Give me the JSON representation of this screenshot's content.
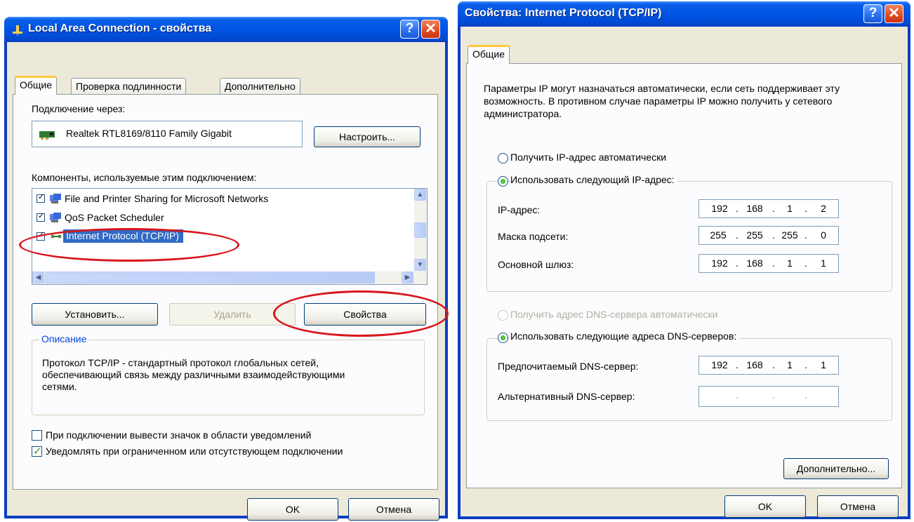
{
  "left_window": {
    "title": "Local Area Connection - свойства",
    "tabs": [
      "Общие",
      "Проверка подлинности",
      "Дополнительно"
    ],
    "connect_via_label": "Подключение через:",
    "adapter_name": "Realtek RTL8169/8110 Family Gigabit",
    "configure_button": "Настроить...",
    "components_label": "Компоненты, используемые этим подключением:",
    "components": [
      {
        "name": "File and Printer Sharing for Microsoft Networks",
        "checked": true
      },
      {
        "name": "QoS Packet Scheduler",
        "checked": true
      },
      {
        "name": "Internet Protocol (TCP/IP)",
        "checked": true,
        "selected": true
      }
    ],
    "install_button": "Установить...",
    "remove_button": "Удалить",
    "properties_button": "Свойства",
    "description_group": "Описание",
    "description_text": "Протокол TCP/IP - стандартный протокол глобальных сетей, обеспечивающий связь между различными взаимодействующими сетями.",
    "show_icon_checkbox": "При подключении вывести значок в области уведомлений",
    "show_icon_checked": false,
    "notify_checkbox": "Уведомлять при ограниченном или отсутствующем подключении",
    "notify_checked": true,
    "ok_button": "OK",
    "cancel_button": "Отмена"
  },
  "right_window": {
    "title": "Свойства: Internet Protocol (TCP/IP)",
    "tab": "Общие",
    "intro_text": "Параметры IP могут назначаться автоматически, если сеть поддерживает эту возможность. В противном случае параметры IP можно получить у сетевого администратора.",
    "auto_ip_radio": "Получить IP-адрес автоматически",
    "manual_ip_radio": "Использовать следующий IP-адрес:",
    "ip_label": "IP-адрес:",
    "ip_value": [
      "192",
      "168",
      "1",
      "2"
    ],
    "mask_label": "Маска подсети:",
    "mask_value": [
      "255",
      "255",
      "255",
      "0"
    ],
    "gateway_label": "Основной шлюз:",
    "gateway_value": [
      "192",
      "168",
      "1",
      "1"
    ],
    "auto_dns_radio": "Получить адрес DNS-сервера автоматически",
    "manual_dns_radio": "Использовать следующие адреса DNS-серверов:",
    "preferred_dns_label": "Предпочитаемый DNS-сервер:",
    "preferred_dns_value": [
      "192",
      "168",
      "1",
      "1"
    ],
    "alternate_dns_label": "Альтернативный DNS-сервер:",
    "alternate_dns_value": [
      "",
      "",
      "",
      ""
    ],
    "advanced_button": "Дополнительно...",
    "ok_button": "OK",
    "cancel_button": "Отмена"
  },
  "colors": {
    "titlebar": "#0054e3",
    "dialog_bg": "#ece9d8",
    "highlight_ellipse": "#d8151b",
    "selection": "#316ac5"
  }
}
